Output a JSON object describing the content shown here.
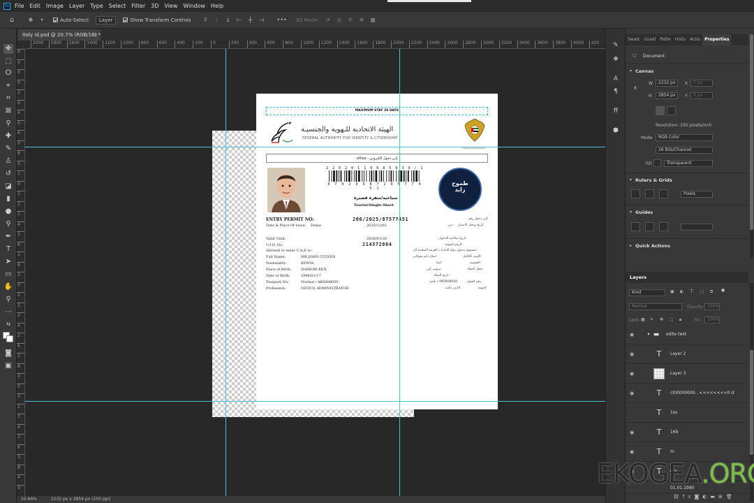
{
  "menu": {
    "app_icon": "Ps",
    "items": [
      "File",
      "Edit",
      "Image",
      "Layer",
      "Type",
      "Select",
      "Filter",
      "3D",
      "View",
      "Window",
      "Help"
    ]
  },
  "options": {
    "auto_select_label": "Auto-Select:",
    "auto_select_target": "Layer",
    "show_transform_label": "Show Transform Controls",
    "three_d_mode": "3D Mode:",
    "more": "•••"
  },
  "doc_tab": {
    "title": "Italy id.psd @ 20.7% (RGB/16) *",
    "close": "×"
  },
  "ruler_h": [
    "2000",
    "1800",
    "1600",
    "1400",
    "1200",
    "1000",
    "800",
    "600",
    "400",
    "200",
    "0",
    "200",
    "400",
    "600",
    "800",
    "1000",
    "1200",
    "1400",
    "1600",
    "1800",
    "2000",
    "2200",
    "2400",
    "2600",
    "2800",
    "3000",
    "3200",
    "3400",
    "3600",
    "3800",
    "4000",
    "420"
  ],
  "ruler_v": [
    "0",
    "0",
    "0",
    "0",
    "2",
    "0",
    "4",
    "0",
    "6",
    "0",
    "8",
    "0",
    "1",
    "0",
    "1",
    "2",
    "1",
    "4",
    "1",
    "6",
    "1",
    "8",
    "2",
    "0",
    "2",
    "2",
    "2",
    "4",
    "2",
    "6",
    "2",
    "8",
    "3",
    "0",
    "3",
    "2",
    "3",
    "4",
    "3",
    "6",
    "3",
    "8",
    "4",
    "0"
  ],
  "document": {
    "max_stay": "MAXIMUM STAY 30 DAYS",
    "authority_ar": "الهيئة الاتحادية للـهوية والجنسيـة",
    "authority_en": "FEDERAL AUTHORITY FOR IDENTITY & CITIZENSHIP",
    "emblem_caption": "United Arab Emirates",
    "evisa": "eVisa - إذن دخول الكتروني",
    "barcode_top": "2 2 0 2 0 1 1 0 6 8 5 8 3 9 / 1",
    "barcode_bottom": "0 7 0 2 0 6 8 7 2 0 5 7 7 4 5 1",
    "seal_text": "طموح\nزايد",
    "type_ar": "سياحية/سفرة قصيرة",
    "type_en": "Tourist/Single-Short",
    "entry_permit_label": "ENTRY PERMIT NO:",
    "entry_permit_no": "206/2025/87577451",
    "entry_permit_ar": "إذن دخول رقم:",
    "date_place_label": "Date & Place Of Issue:",
    "issue_place": "Dubai",
    "issue_date": "2025/12/02",
    "date_place_ar": "تاريخ ومحل الاصدار:",
    "issue_place_ar": "دبي",
    "valid_until_label": "Valid Until:",
    "valid_until": "2026/01/30",
    "valid_until_ar": "تاريخ صلاحية الدخول:",
    "uid_label": "U.I.D. No:",
    "uid": "214572884",
    "uid_ar": "الرقم الموحد:",
    "allowed_label": "Allowed to enter U.A.E to:",
    "allowed_ar": "مسموح بدخول دولة الامارات العربية المتحدة الى:",
    "fullname_label": "Full Name:",
    "fullname": "MR JOHN CITIZEN",
    "fullname_ar": "ايمال نادو متوكاني",
    "fullname_ar_label": "الإسم بالكامل:",
    "nationality_label": "Nationality:",
    "nationality": "KENYA",
    "nationality_ar": "كينيا",
    "nationality_ar_label": "الجنسية:",
    "pob_label": "Place of Birth:",
    "pob": "NAIROBI KEN",
    "pob_ar": "نيروبي كين",
    "pob_ar_label": "محل الميلاد:",
    "dob_label": "Date of Birth:",
    "dob": "1996/01/17",
    "dob_ar_label": "تاريخ الميلاد:",
    "passport_label": "Passport No:",
    "passport": "Normal / AK0808050",
    "passport_ar": "عادي / AK0808050",
    "passport_ar_label": "رقم الجواز:",
    "profession_label": "Profession:",
    "profession": "OFFICE ADMINISTRATOR",
    "profession_ar": "اداري مكتب",
    "profession_ar_label": "المهنة:"
  },
  "panels": {
    "tabs": [
      "Swatc",
      "Gradi",
      "Patte",
      "Histo",
      "Actio",
      "Properties"
    ],
    "document_label": "Document",
    "canvas_section": "Canvas",
    "w_label": "W",
    "w_value": "2232 px",
    "h_label": "H",
    "h_value": "2854 px",
    "x_label": "X",
    "x_value": "0 px",
    "y_label": "Y",
    "y_value": "0 px",
    "resolution": "Resolution: 250 pixels/inch",
    "mode_label": "Mode",
    "mode_value": "RGB Color",
    "depth_value": "16 Bits/Channel",
    "fill_label": "Fill",
    "fill_value": "Transparent",
    "rulers_section": "Rulers & Grids",
    "rulers_unit": "Pixels",
    "guides_section": "Guides",
    "quick_actions": "Quick Actions"
  },
  "layers": {
    "title": "Layers",
    "kind": "Kind",
    "blend": "Normal",
    "opacity_label": "Opacity:",
    "opacity": "100%",
    "lock_label": "Lock:",
    "fill_label": "Fill:",
    "fill": "100%",
    "items": [
      {
        "name": "edite text",
        "type": "group"
      },
      {
        "name": "Layer 2",
        "type": "text"
      },
      {
        "name": "Layer 3",
        "type": "image"
      },
      {
        "name": "citi0000000...<<<<<<<<0 d",
        "type": "text"
      },
      {
        "name": "1ss",
        "type": "text"
      },
      {
        "name": "169",
        "type": "text"
      },
      {
        "name": "m",
        "type": "text"
      },
      {
        "name": "ma",
        "type": "text"
      },
      {
        "name": "01.01.1990",
        "type": "text"
      }
    ]
  },
  "status": {
    "zoom": "20.66%",
    "doc_info": "2232 px x 2854 px (250 ppi)"
  },
  "watermark": {
    "main": "EKOGEA",
    "tld": ".ORG"
  },
  "colors": {
    "accent": "#31a8ff",
    "guide": "#4cc3d4",
    "watermark_org": "#7ac143"
  }
}
